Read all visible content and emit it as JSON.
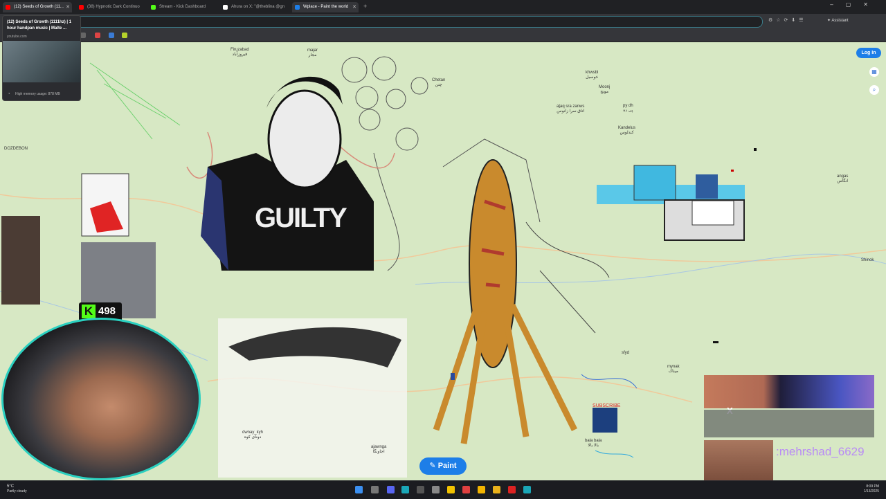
{
  "browser": {
    "tabs": [
      {
        "title": "(12) Seeds of Growth (1111hz) | 1 hour handpan music | Malte ...",
        "active": true,
        "color": "#ff0000",
        "icon": "youtube-icon"
      },
      {
        "title": "(38) Hypnotic Dark Continuo...",
        "active": false,
        "color": "#ff0000",
        "icon": "youtube-icon"
      },
      {
        "title": "Stream - Kick Dashboard",
        "active": false,
        "color": "#53fc18",
        "icon": "kick-icon"
      },
      {
        "title": "Ahura on X: \"@theblina @gn...",
        "active": false,
        "color": "#ffffff",
        "icon": "x-icon"
      },
      {
        "title": "Wplace - Paint the world",
        "active": true,
        "color": "#1d7ee8",
        "icon": "wplace-icon"
      }
    ],
    "tab_labels": [
      "(12) Seeds of Growth (11...",
      "(38) Hypnotic Dark Continuo",
      "Stream - Kick Dashboard",
      "Ahura on X: \"@theblina @gn",
      "Wplace - Paint the world"
    ],
    "assistant_label": "Assistant"
  },
  "tooltip": {
    "title": "(12) Seeds of Growth (1111hz) | 1 hour handpan music | Malte ...",
    "domain": "youtube.com",
    "memory": "High memory usage: 878 MB"
  },
  "map": {
    "login_label": "Log In",
    "paint_label": "Paint",
    "places": [
      {
        "name": "Firuzabad",
        "sub": "فیروزآباد"
      },
      {
        "name": "majar",
        "sub": "مجار"
      },
      {
        "name": "Chetan",
        "sub": "چتن"
      },
      {
        "name": "khwsbl",
        "sub": "خوسبل"
      },
      {
        "name": "Moonj",
        "sub": "مونج"
      },
      {
        "name": "aṯaq sra zanws",
        "sub": "اتاق سرا زانوس"
      },
      {
        "name": "py dh",
        "sub": "پی ده"
      },
      {
        "name": "Kandelus",
        "sub": "کندلوس"
      },
      {
        "name": "angas",
        "sub": "انگاس"
      },
      {
        "name": "Shinok",
        "sub": ""
      },
      {
        "name": "DOZDEBON",
        "sub": ""
      },
      {
        "name": "dwnay_kyh",
        "sub": "دونای کوه"
      },
      {
        "name": "ajawnga",
        "sub": "اجاونگا"
      },
      {
        "name": "mynak",
        "sub": "میناک"
      },
      {
        "name": "sfyd",
        "sub": ""
      },
      {
        "name": "bala bala",
        "sub": "بالا بالا"
      }
    ],
    "shirt_text": "GUILTY",
    "subscribe_text": "SUBSCRIBE"
  },
  "overlay": {
    "kick_letter": "K",
    "kick_count": "498",
    "alert_username": ":mehrshad_6629",
    "alert_x": "X"
  },
  "taskbar": {
    "temp": "5°C",
    "weather": "Partly cloudy",
    "time": "8:09 PM",
    "date": "1/13/2025"
  }
}
